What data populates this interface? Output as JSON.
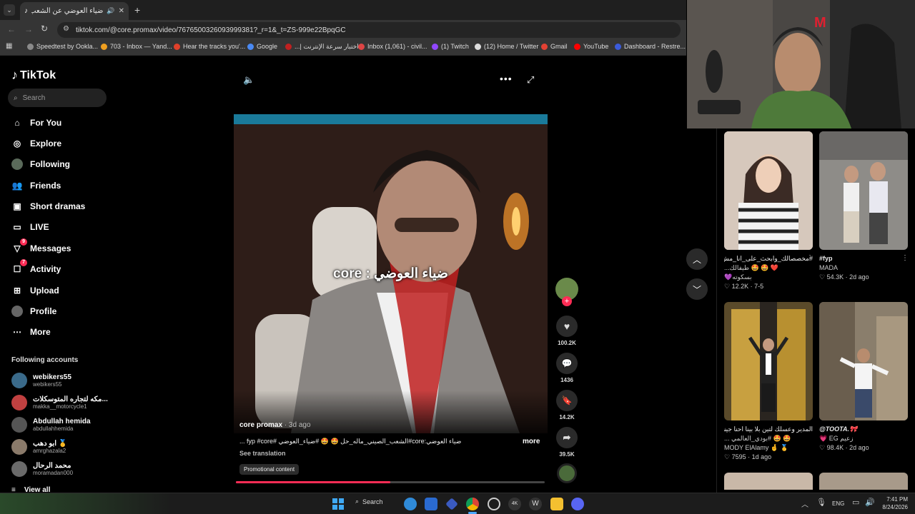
{
  "browser": {
    "tab_title": "ضياء العوضي عن الشعب الـ",
    "url": "tiktok.com/@core.promax/video/7676500326093999381?_r=1&_t=ZS-999e22BpqGC",
    "bookmarks": [
      {
        "label": "Speedtest by Ookla...",
        "color": "#8a8a8a"
      },
      {
        "label": "703 - Inbox — Yand...",
        "color": "#f0a020"
      },
      {
        "label": "Hear the tracks you'...",
        "color": "#e0402a"
      },
      {
        "label": "Google",
        "color": "#4a8af4"
      },
      {
        "label": "اختبار سرعة الإنترنت |...",
        "color": "#c02020"
      },
      {
        "label": "Inbox (1,061) - civil...",
        "color": "#d44"
      },
      {
        "label": "(1) Twitch",
        "color": "#9147ff"
      },
      {
        "label": "(12) Home / Twitter",
        "color": "#ddd"
      },
      {
        "label": "Gmail",
        "color": "#e34133"
      },
      {
        "label": "YouTube",
        "color": "#ff0000"
      },
      {
        "label": "Dashboard - Restre...",
        "color": "#3b5bdb"
      }
    ]
  },
  "tiktok": {
    "logo": "TikTok",
    "search_placeholder": "Search",
    "nav": [
      {
        "label": "For You",
        "icon": "home-icon"
      },
      {
        "label": "Explore",
        "icon": "compass-icon"
      },
      {
        "label": "Following",
        "icon": "following-icon"
      },
      {
        "label": "Friends",
        "icon": "friends-icon"
      },
      {
        "label": "Short dramas",
        "icon": "drama-icon"
      },
      {
        "label": "LIVE",
        "icon": "live-icon"
      },
      {
        "label": "Messages",
        "icon": "messages-icon",
        "badge": "9"
      },
      {
        "label": "Activity",
        "icon": "activity-icon",
        "badge": "7"
      },
      {
        "label": "Upload",
        "icon": "upload-icon"
      },
      {
        "label": "Profile",
        "icon": "profile-icon"
      },
      {
        "label": "More",
        "icon": "more-icon"
      }
    ],
    "following_title": "Following accounts",
    "following": [
      {
        "name": "webikers55",
        "handle": "webikers55"
      },
      {
        "name": "مكه لتجاره المتوسكلات...",
        "handle": "makka__motorcycle1"
      },
      {
        "name": "Abdullah hemida",
        "handle": "abdullahhemida"
      },
      {
        "name": "ابو دهب 🥇",
        "handle": "amrghazala2"
      },
      {
        "name": "محمد الرحال",
        "handle": "moramadan000"
      }
    ],
    "view_all": "View all"
  },
  "video": {
    "overlay_text": "ضياء العوضي : core",
    "author": "core promax",
    "time_ago": "· 3d ago",
    "caption": "ضياء العوضي:core#الشعب_الصيني_ماله_حل 🤩 🤩 #ضياء_العوضي #fyp #core ...",
    "more": "more",
    "see_translation": "See translation",
    "promo_label": "Promotional content",
    "progress": 0.5
  },
  "actions": {
    "likes": "100.2K",
    "comments": "1436",
    "saves": "14.2K",
    "shares": "39.5K"
  },
  "recommendations": [
    {
      "caption": "#مخصصالك_وابحث_على_انا_مش...",
      "caption2": "❤️ 🤩 🤩 طيفالك...",
      "extra": "بسكوته💜",
      "author": "",
      "stat": "12.2K",
      "date": "7-5",
      "bg": "#d9cfc6"
    },
    {
      "caption": "#fyp",
      "caption2": "",
      "extra": "",
      "author": "MADA",
      "stat": "54.3K",
      "date": "2d ago",
      "bg": "#8a8a86"
    },
    {
      "caption": "المدير وعسلك لتين بلا بينا احنا جينا",
      "caption2": "🤩 🤩 #بودي_العالمي ...",
      "extra": "",
      "author": "MODY ElAlamy 🤞 🥇",
      "stat": "7595",
      "date": "1d ago",
      "bg": "#7a6a3a"
    },
    {
      "caption": "@TOOTA.🎀",
      "caption2": "",
      "extra": "",
      "author": "زعيم EG 💗",
      "stat": "98.4K",
      "date": "2d ago",
      "bg": "#8a7e6c"
    }
  ],
  "taskbar": {
    "search": "Search",
    "lang": "ENG",
    "time": "7:41 PM",
    "date": "8/24/2026"
  }
}
